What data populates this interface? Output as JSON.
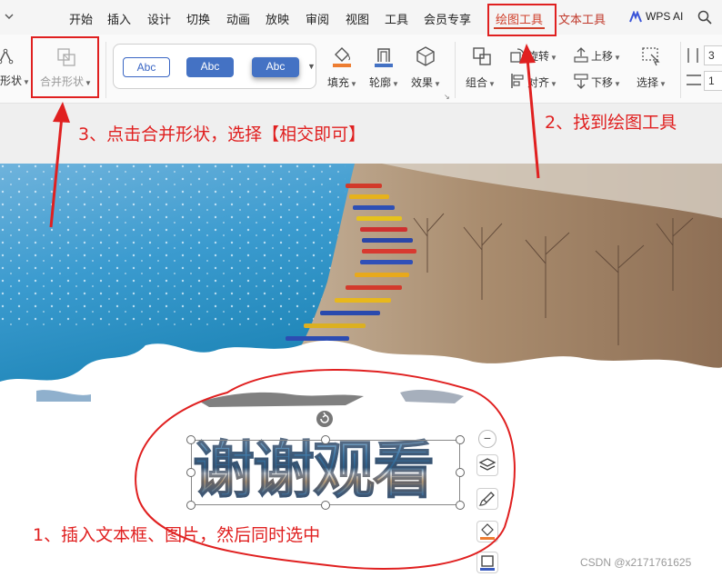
{
  "menubar": {
    "tabs": [
      {
        "label": "开始",
        "name": "tab-home"
      },
      {
        "label": "插入",
        "name": "tab-insert"
      },
      {
        "label": "设计",
        "name": "tab-design"
      },
      {
        "label": "切换",
        "name": "tab-transition"
      },
      {
        "label": "动画",
        "name": "tab-animation"
      },
      {
        "label": "放映",
        "name": "tab-slideshow"
      },
      {
        "label": "审阅",
        "name": "tab-review"
      },
      {
        "label": "视图",
        "name": "tab-view"
      },
      {
        "label": "工具",
        "name": "tab-tools"
      },
      {
        "label": "会员专享",
        "name": "tab-member"
      },
      {
        "label": "绘图工具",
        "name": "tab-drawing-tools"
      },
      {
        "label": "文本工具",
        "name": "tab-text-tools"
      }
    ],
    "wps_ai": "WPS AI",
    "active_tab": "绘图工具",
    "colors": {
      "active": "#d0402b",
      "accent_tab": "#c0392b"
    }
  },
  "ribbon": {
    "shape_label": "形状",
    "merge_shape_label": "合并形状",
    "style_samples": [
      "Abc",
      "Abc",
      "Abc"
    ],
    "fill_label": "填充",
    "outline_label": "轮廓",
    "effect_label": "效果",
    "combine_label": "组合",
    "rotate_label": "旋转",
    "align_label": "对齐",
    "up_label": "上移",
    "down_label": "下移",
    "select_label": "选择",
    "size_value_1": "3",
    "size_value_2": "1",
    "colors": {
      "fill_bar": "#ed7d31",
      "style_blue": "#4472c4"
    }
  },
  "canvas": {
    "word_art_text": "谢谢观看"
  },
  "annotations": {
    "step1": "1、插入文本框、图片，然后同时选中",
    "step2": "2、找到绘图工具",
    "step3": "3、点击合并形状，选择【相交即可】",
    "color": "#e02020"
  },
  "watermark": "CSDN @x2171761625"
}
